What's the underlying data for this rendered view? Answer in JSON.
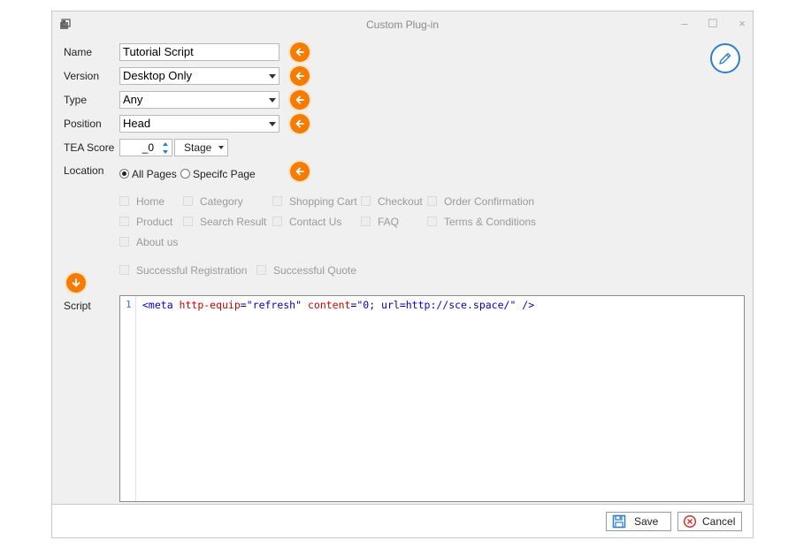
{
  "window": {
    "title": "Custom Plug-in",
    "controls": {
      "minimize": "–",
      "maximize": "☐",
      "close": "×"
    }
  },
  "form": {
    "name": {
      "label": "Name",
      "value": "Tutorial Script"
    },
    "version": {
      "label": "Version",
      "value": "Desktop Only"
    },
    "type": {
      "label": "Type",
      "value": "Any"
    },
    "position": {
      "label": "Position",
      "value": "Head"
    },
    "tea_score": {
      "label": "TEA Score",
      "value": "_0",
      "stage": "Stage"
    },
    "location": {
      "label": "Location",
      "options": [
        {
          "label": "All Pages",
          "selected": true
        },
        {
          "label": "Specifc Page",
          "selected": false
        }
      ]
    },
    "pages": {
      "row1": [
        "Home",
        "Category",
        "Shopping Cart",
        "Checkout",
        "Order Confirmation"
      ],
      "row2": [
        "Product",
        "Search Result",
        "Contact Us",
        "FAQ",
        "Terms & Conditions"
      ],
      "row3": [
        "About us"
      ],
      "row4": [
        "Successful Registration",
        "Successful Quote"
      ]
    },
    "script": {
      "label": "Script",
      "line_number": "1",
      "tokens": {
        "t1": "<meta",
        "t2": " http-equip",
        "t3": "=\"refresh\"",
        "t4": " content",
        "t5": "=\"0; url=http://sce.space/\"",
        "t6": " />"
      }
    }
  },
  "buttons": {
    "save": "Save",
    "cancel": "Cancel"
  },
  "colors": {
    "accent_orange": "#f57c00",
    "accent_blue": "#2a7fd4",
    "cancel_red": "#e03030"
  },
  "icons": {
    "help_arrow_left": "arrow-left-icon",
    "help_arrow_down": "arrow-down-icon",
    "edit": "pencil-icon"
  }
}
